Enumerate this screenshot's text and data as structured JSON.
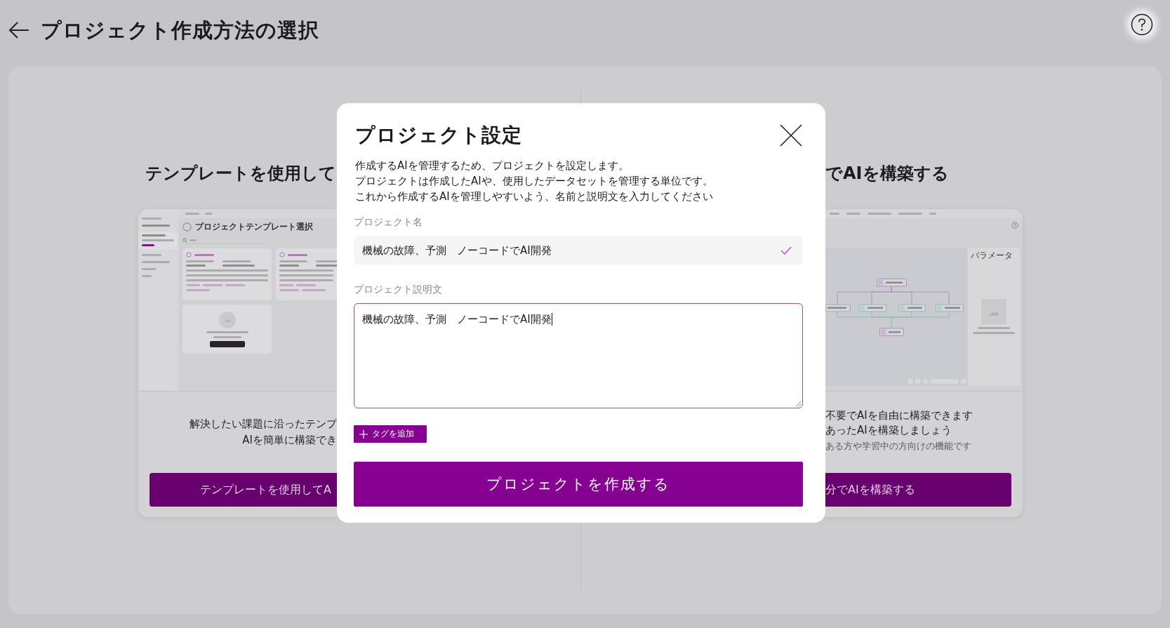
{
  "header": {
    "title": "プロジェクト作成方法の選択"
  },
  "methods": [
    {
      "kind": "template",
      "heading": "テンプレートを使用して",
      "preview": {
        "title": "プロジェクトテンプレート選択"
      },
      "description": [
        "解決したい課題に沿ったテンプ",
        "AIを簡単に構築でき"
      ],
      "button": "テンプレートを使用してA"
    },
    {
      "kind": "custom",
      "heading": "でAIを構築する",
      "preview": {
        "panel_title": "パラメータ"
      },
      "description": [
        "不要でAIを自由に構築できます",
        "あったAIを構築しましょう"
      ],
      "note": "ある方や学習中の方向けの機能です",
      "button": "分でAIを構築する"
    }
  ],
  "dialog": {
    "title": "プロジェクト設定",
    "description": [
      "作成するAIを管理するため、プロジェクトを設定します。",
      "プロジェクトは作成したAIや、使用したデータセットを管理する単位です。",
      "これから作成するAIを管理しやすいよう、名前と説明文を入力してください"
    ],
    "name_field": {
      "label": "プロジェクト名",
      "value": "機械の故障、予測　ノーコードでAI開発",
      "valid": true
    },
    "description_field": {
      "label": "プロジェクト説明文",
      "value": "機械の故障、予測　ノーコードでAI開発",
      "focused": true
    },
    "tag_button": "タグを追加",
    "submit_button": "プロジェクトを作成する"
  }
}
